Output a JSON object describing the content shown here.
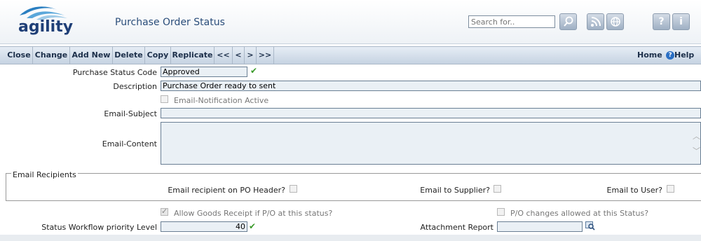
{
  "header": {
    "logo_text": "agility",
    "title": "Purchase Order Status",
    "search_placeholder": "Search for..",
    "buttons": [
      "search-icon",
      "rss-icon",
      "globe-icon",
      "help-icon",
      "info-icon"
    ]
  },
  "toolbar": {
    "items": [
      "Close",
      "Change",
      "Add New",
      "Delete",
      "Copy",
      "Replicate",
      "<<",
      "<",
      ">",
      ">>"
    ],
    "home": "Home",
    "help": "Help"
  },
  "form": {
    "status_code_label": "Purchase Status Code",
    "status_code_value": "Approved",
    "description_label": "Description",
    "description_value": "Purchase Order ready to sent",
    "email_notification_label": "Email-Notification Active",
    "email_subject_label": "Email-Subject",
    "email_subject_value": "",
    "email_content_label": "Email-Content",
    "email_content_value": "",
    "recipients_legend": "Email Recipients",
    "recipient_po_header_label": "Email recipient on PO Header?",
    "email_supplier_label": "Email to Supplier?",
    "email_user_label": "Email to User?",
    "allow_goods_receipt_label": "Allow Goods Receipt if P/O at this status?",
    "allow_goods_receipt_checked": true,
    "po_changes_label": "P/O changes allowed at this Status?",
    "priority_label": "Status Workflow priority Level",
    "priority_value": "40",
    "attachment_label": "Attachment Report",
    "attachment_value": ""
  },
  "colors": {
    "accent": "#2a4d7a",
    "toolbar": "#c6d3e2",
    "field_bg": "#eaf0f5",
    "check_green": "#3a9a2a"
  }
}
